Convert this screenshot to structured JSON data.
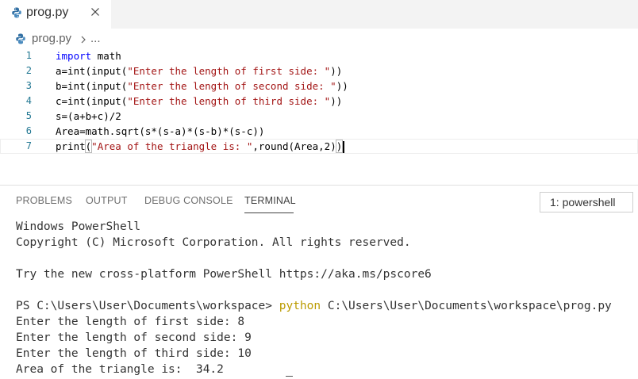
{
  "tab": {
    "icon": "python-file-icon",
    "label": "prog.py",
    "close_icon": "close-icon"
  },
  "breadcrumb": {
    "file": "prog.py",
    "ellipsis": "..."
  },
  "editor": {
    "lines": [
      {
        "number": "1",
        "text": "import math"
      },
      {
        "number": "2",
        "text": "a=int(input(\"Enter the length of first side: \"))"
      },
      {
        "number": "3",
        "text": "b=int(input(\"Enter the length of second side: \"))"
      },
      {
        "number": "4",
        "text": "c=int(input(\"Enter the length of third side: \"))"
      },
      {
        "number": "5",
        "text": "s=(a+b+c)/2"
      },
      {
        "number": "6",
        "text": "Area=math.sqrt(s*(s-a)*(s-b)*(s-c))"
      },
      {
        "number": "7",
        "text": "print(\"Area of the triangle is: \",round(Area,2))"
      }
    ],
    "colors": {
      "keyword": "#0000ff",
      "string": "#a31515",
      "line_number": "#237893"
    }
  },
  "panel": {
    "tabs": [
      {
        "label": "PROBLEMS"
      },
      {
        "label": "OUTPUT"
      },
      {
        "label": "DEBUG CONSOLE"
      },
      {
        "label": "TERMINAL",
        "active": true
      }
    ],
    "terminal_selector": "1: powershell"
  },
  "terminal": {
    "lines": [
      "Windows PowerShell",
      "Copyright (C) Microsoft Corporation. All rights reserved.",
      "",
      "Try the new cross-platform PowerShell https://aka.ms/pscore6",
      "",
      {
        "prompt": "PS C:\\Users\\User\\Documents\\workspace> ",
        "command": "python",
        "args": " C:\\Users\\User\\Documents\\workspace\\prog.py"
      },
      "Enter the length of first side: 8",
      "Enter the length of second side: 9",
      "Enter the length of third side: 10",
      "Area of the triangle is:  34.2"
    ],
    "command_color": "#bb9b00"
  }
}
